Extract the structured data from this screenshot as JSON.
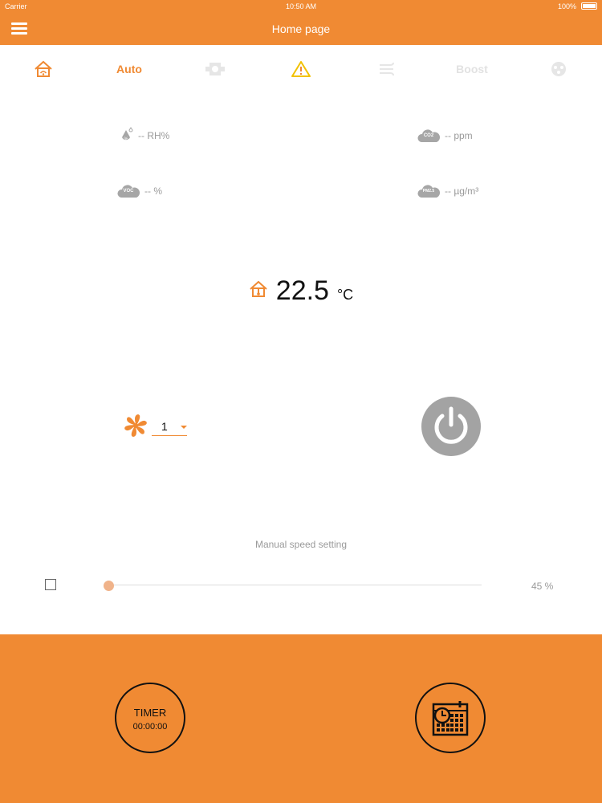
{
  "status_bar": {
    "carrier": "Carrier",
    "time": "10:50 AM",
    "battery": "100%"
  },
  "header": {
    "title": "Home page"
  },
  "tabs": [
    {
      "id": "home",
      "label": "",
      "icon": "house-wifi-icon",
      "state": "active"
    },
    {
      "id": "auto",
      "label": "Auto",
      "state": "active"
    },
    {
      "id": "ventilation",
      "label": "",
      "icon": "fan-unit-icon",
      "state": "inactive"
    },
    {
      "id": "alarm",
      "label": "",
      "icon": "warning-icon",
      "state": "warning"
    },
    {
      "id": "airflow",
      "label": "",
      "icon": "airflow-icon",
      "state": "inactive"
    },
    {
      "id": "boost",
      "label": "Boost",
      "state": "inactive"
    },
    {
      "id": "hood",
      "label": "",
      "icon": "hood-icon",
      "state": "inactive"
    }
  ],
  "sensors": {
    "humidity": {
      "icon_text": "%",
      "value": "-- RH%"
    },
    "co2": {
      "icon_text": "CO2",
      "value": "-- ppm"
    },
    "voc": {
      "icon_text": "VOC",
      "value": "-- %"
    },
    "pm25": {
      "icon_text": "PM2.5",
      "value": "-- µg/m³"
    }
  },
  "temperature": {
    "value": "22.5",
    "unit": "°C"
  },
  "fan": {
    "speed": "1"
  },
  "manual_speed": {
    "label": "Manual speed setting",
    "value_text": "45 %",
    "value": 45,
    "enabled": false
  },
  "timer": {
    "label": "TIMER",
    "time": "00:00:00"
  },
  "colors": {
    "accent": "#f08a33",
    "inactive": "#e0e0e0",
    "warning": "#f2c200",
    "power": "#a3a3a3"
  }
}
